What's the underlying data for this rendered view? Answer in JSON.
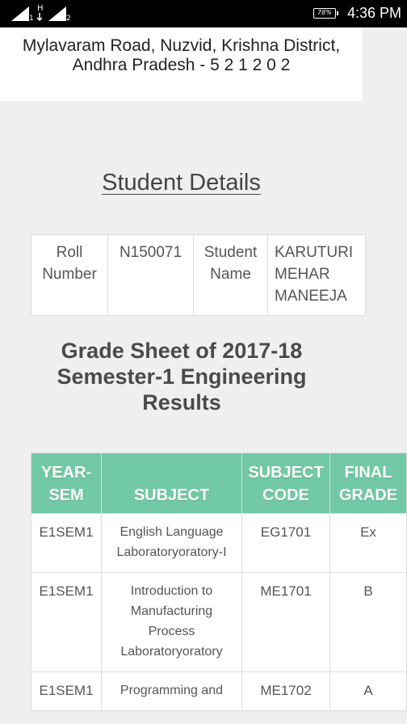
{
  "status_bar": {
    "sim1_label": "1",
    "sim1_network": "H",
    "sim2_label": "2",
    "battery": "78%",
    "time": "4:36 PM"
  },
  "address": {
    "line1": "Mylavaram Road, Nuzvid, Krishna District,",
    "line2": "Andhra Pradesh - 5 2 1 2 0 2"
  },
  "student_details": {
    "title": "Student Details",
    "roll_label": "Roll Number",
    "roll_value": "N150071",
    "name_label": "Student Name",
    "name_value": "KARUTURI MEHAR MANEEJA"
  },
  "grade_sheet": {
    "title": "Grade Sheet of 2017-18 Semester-1 Engineering Results",
    "headers": {
      "year_sem": "YEAR-SEM",
      "subject": "SUBJECT",
      "subject_code": "SUBJECT CODE",
      "final_grade": "FINAL GRADE"
    },
    "rows": [
      {
        "year_sem": "E1SEM1",
        "subject": "English Language Laboratoryoratory-I",
        "code": "EG1701",
        "grade": "Ex"
      },
      {
        "year_sem": "E1SEM1",
        "subject": "Introduction to Manufacturing Process Laboratoryoratory",
        "code": "ME1701",
        "grade": "B"
      },
      {
        "year_sem": "E1SEM1",
        "subject": "Programming and",
        "code": "ME1702",
        "grade": "A"
      }
    ]
  }
}
